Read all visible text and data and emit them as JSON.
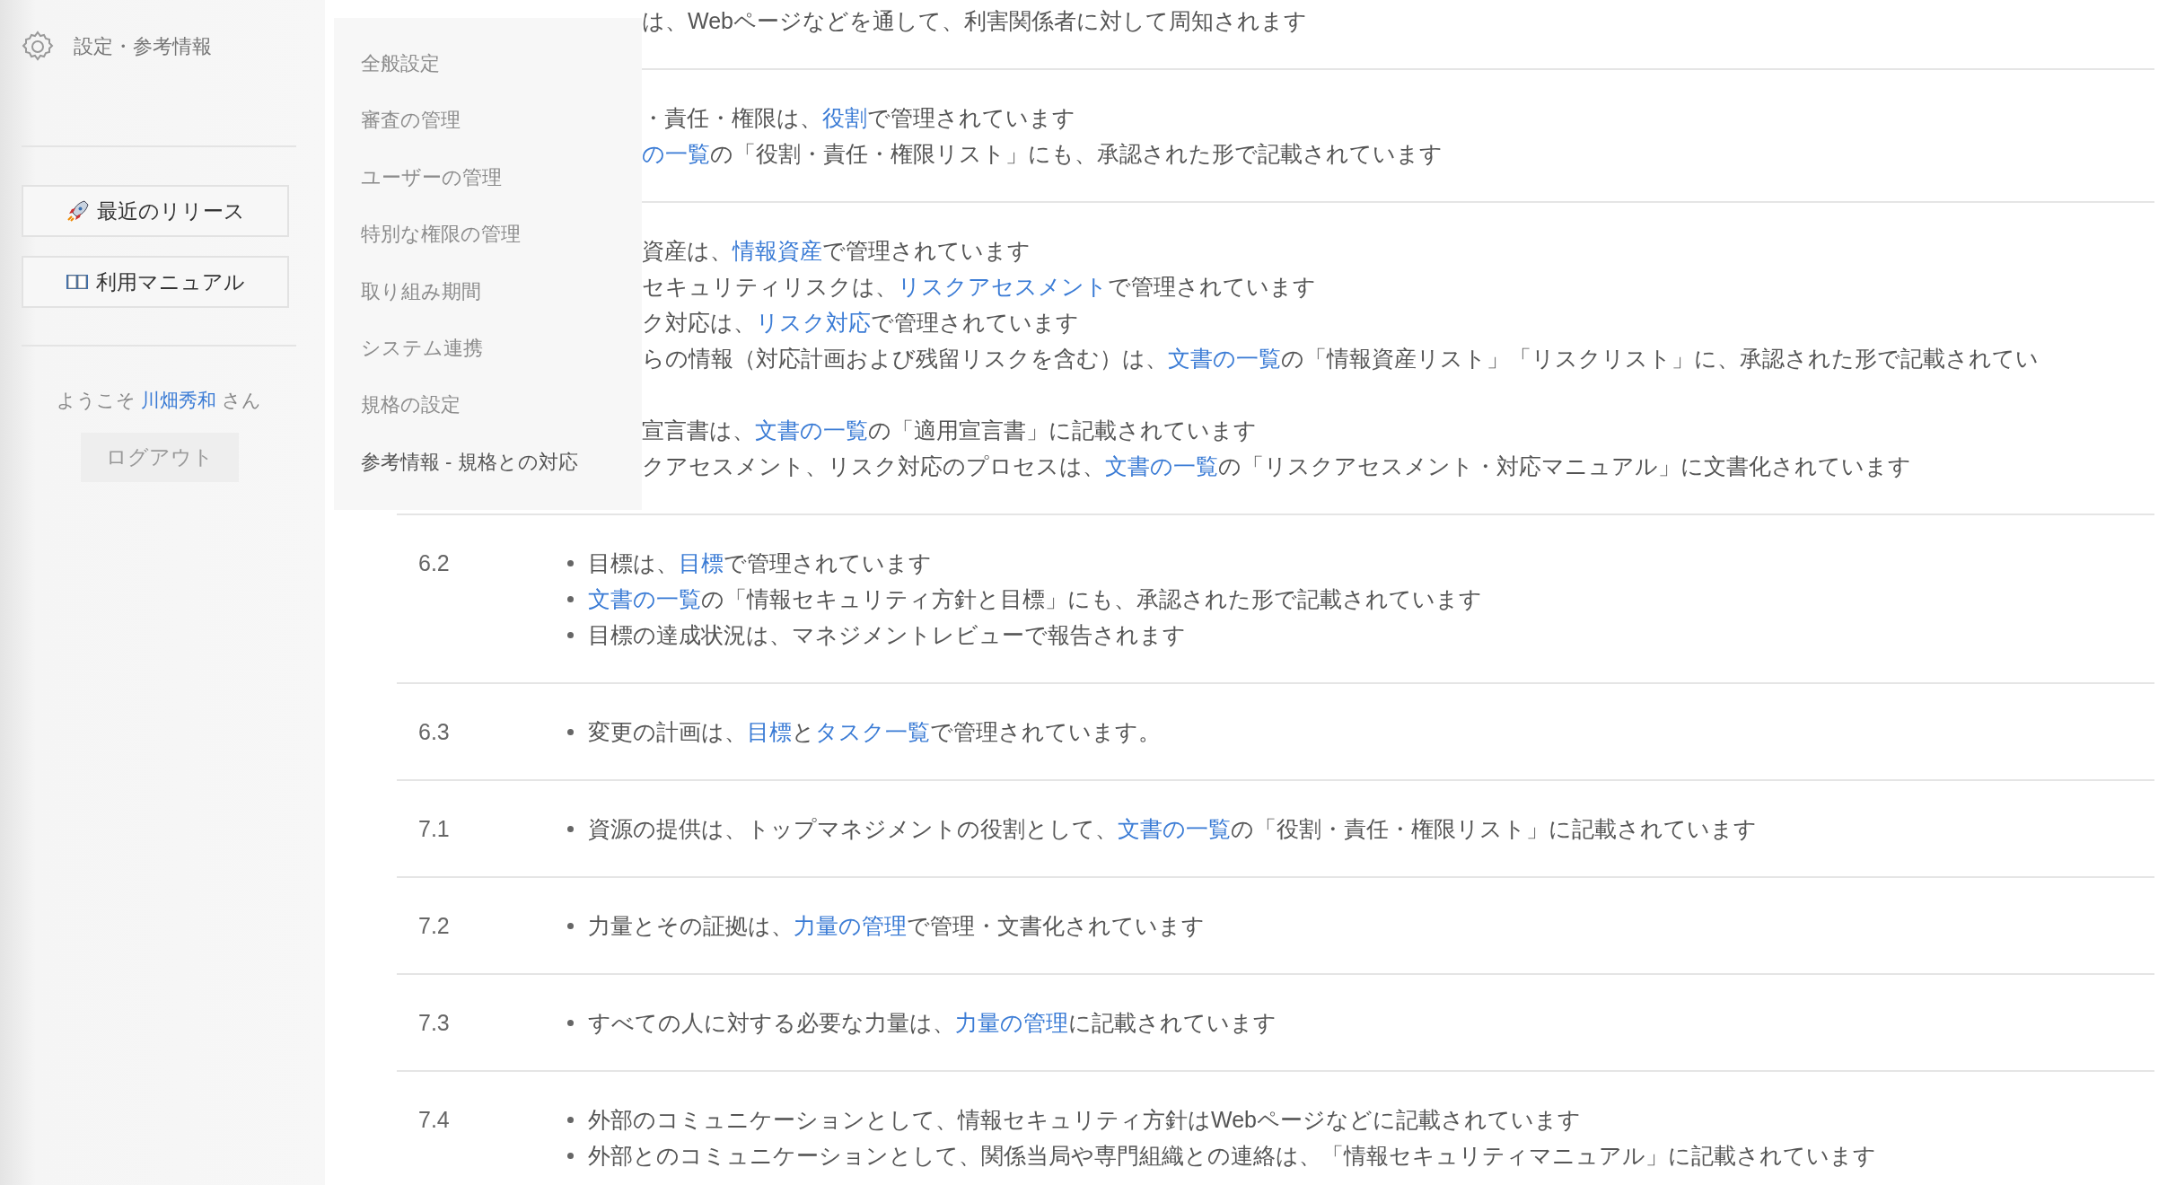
{
  "sidebar": {
    "title": "設定・参考情報",
    "buttons": [
      {
        "label": "最近のリリース",
        "kind": "rocket"
      },
      {
        "label": "利用マニュアル",
        "kind": "book"
      }
    ],
    "welcome": {
      "prefix": "ようこそ",
      "user": "川畑秀和",
      "suffix": "さん"
    },
    "logout": "ログアウト"
  },
  "menu": {
    "items": [
      {
        "label": "全般設定",
        "selected": false
      },
      {
        "label": "審査の管理",
        "selected": false
      },
      {
        "label": "ユーザーの管理",
        "selected": false
      },
      {
        "label": "特別な権限の管理",
        "selected": false
      },
      {
        "label": "取り組み期間",
        "selected": false
      },
      {
        "label": "システム連携",
        "selected": false
      },
      {
        "label": "規格の設定",
        "selected": false
      },
      {
        "label": "参考情報 - 規格との対応",
        "selected": true
      }
    ]
  },
  "table": {
    "rows": [
      {
        "kind": "covered",
        "paragraphs": [
          [
            [
              {
                "text": "は、Webページなどを通して、利害関係者に対して周知されます",
                "link": false
              }
            ]
          ]
        ]
      },
      {
        "kind": "covered",
        "paragraphs": [
          [
            [
              {
                "text": "・責任・権限は、",
                "link": false
              },
              {
                "text": "役割",
                "link": true
              },
              {
                "text": "で管理されています",
                "link": false
              }
            ],
            [
              {
                "text": "の一覧",
                "link": true
              },
              {
                "text": "の「役割・責任・権限リスト」にも、承認された形で記載されています",
                "link": false
              }
            ]
          ]
        ]
      },
      {
        "kind": "covered",
        "paragraphs": [
          [
            [
              {
                "text": "資産は、",
                "link": false
              },
              {
                "text": "情報資産",
                "link": true
              },
              {
                "text": "で管理されています",
                "link": false
              }
            ],
            [
              {
                "text": "セキュリティリスクは、",
                "link": false
              },
              {
                "text": "リスクアセスメント",
                "link": true
              },
              {
                "text": "で管理されています",
                "link": false
              }
            ],
            [
              {
                "text": "ク対応は、",
                "link": false
              },
              {
                "text": "リスク対応",
                "link": true
              },
              {
                "text": "で管理されています",
                "link": false
              }
            ],
            [
              {
                "text": "らの情報（対応計画および残留リスクを含む）は、",
                "link": false
              },
              {
                "text": "文書の一覧",
                "link": true
              },
              {
                "text": "の「情報資産リスト」「リスクリスト」に、承認された形で記載されてい",
                "link": false
              }
            ]
          ],
          [
            [
              {
                "text": "宣言書は、",
                "link": false
              },
              {
                "text": "文書の一覧",
                "link": true
              },
              {
                "text": "の「適用宣言書」に記載されています",
                "link": false
              }
            ],
            [
              {
                "text": "クアセスメント、リスク対応のプロセスは、",
                "link": false
              },
              {
                "text": "文書の一覧",
                "link": true
              },
              {
                "text": "の「リスクアセスメント・対応マニュアル」に文書化されています",
                "link": false
              }
            ]
          ]
        ]
      },
      {
        "kind": "full",
        "number": "6.2",
        "paragraphs": [
          [
            [
              {
                "text": "目標は、",
                "link": false
              },
              {
                "text": "目標",
                "link": true
              },
              {
                "text": "で管理されています",
                "link": false
              }
            ],
            [
              {
                "text": "文書の一覧",
                "link": true
              },
              {
                "text": "の「情報セキュリティ方針と目標」にも、承認された形で記載されています",
                "link": false
              }
            ],
            [
              {
                "text": "目標の達成状況は、マネジメントレビューで報告されます",
                "link": false
              }
            ]
          ]
        ]
      },
      {
        "kind": "full",
        "number": "6.3",
        "paragraphs": [
          [
            [
              {
                "text": "変更の計画は、",
                "link": false
              },
              {
                "text": "目標",
                "link": true
              },
              {
                "text": "と",
                "link": false
              },
              {
                "text": "タスク一覧",
                "link": true
              },
              {
                "text": "で管理されています。",
                "link": false
              }
            ]
          ]
        ]
      },
      {
        "kind": "full",
        "number": "7.1",
        "paragraphs": [
          [
            [
              {
                "text": "資源の提供は、トップマネジメントの役割として、",
                "link": false
              },
              {
                "text": "文書の一覧",
                "link": true
              },
              {
                "text": "の「役割・責任・権限リスト」に記載されています",
                "link": false
              }
            ]
          ]
        ]
      },
      {
        "kind": "full",
        "number": "7.2",
        "paragraphs": [
          [
            [
              {
                "text": "力量とその証拠は、",
                "link": false
              },
              {
                "text": "力量の管理",
                "link": true
              },
              {
                "text": "で管理・文書化されています",
                "link": false
              }
            ]
          ]
        ]
      },
      {
        "kind": "full",
        "number": "7.3",
        "paragraphs": [
          [
            [
              {
                "text": "すべての人に対する必要な力量は、",
                "link": false
              },
              {
                "text": "力量の管理",
                "link": true
              },
              {
                "text": "に記載されています",
                "link": false
              }
            ]
          ]
        ]
      },
      {
        "kind": "full",
        "number": "7.4",
        "paragraphs": [
          [
            [
              {
                "text": "外部のコミュニケーションとして、情報セキュリティ方針はWebページなどに記載されています",
                "link": false
              }
            ],
            [
              {
                "text": "外部とのコミュニケーションとして、関係当局や専門組織との連絡は、「情報セキュリティマニュアル」に記載されています",
                "link": false
              }
            ]
          ]
        ]
      }
    ]
  }
}
